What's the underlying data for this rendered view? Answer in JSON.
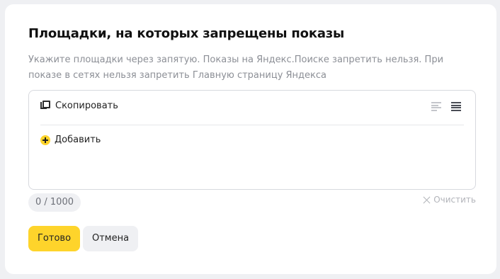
{
  "dialog": {
    "title": "Площадки, на которых запрещены показы",
    "hint": "Укажите площадки через запятую. Показы на Яндекс.Поиске запретить нельзя. При показе в сетях нельзя запретить Главную страницу Яндекса"
  },
  "editor": {
    "copy_label": "Скопировать",
    "copy_icon": "copy-icon",
    "view_icons": [
      "list-view-icon",
      "table-view-icon"
    ],
    "active_view": "table-view-icon",
    "add_label": "Добавить",
    "add_icon": "plus-circle-icon"
  },
  "counter": "0 / 1000",
  "clear_label": "Очистить",
  "buttons": {
    "done": "Готово",
    "cancel": "Отмена"
  },
  "colors": {
    "accent": "#fed42b",
    "background": "#eff0f3",
    "card": "#ffffff"
  }
}
